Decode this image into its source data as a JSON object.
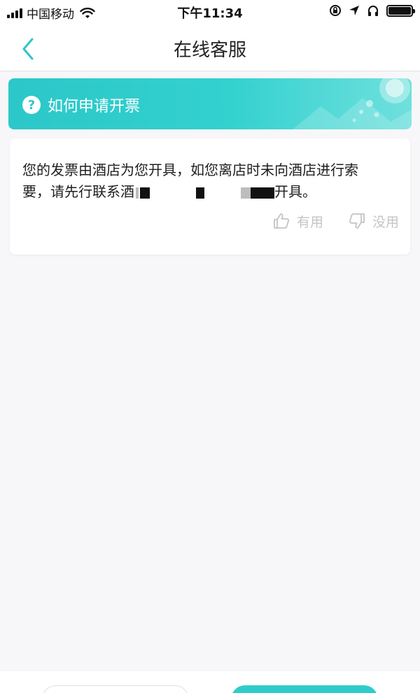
{
  "status_bar": {
    "carrier": "中国移动",
    "time": "下午11:34"
  },
  "nav": {
    "title": "在线客服"
  },
  "question": {
    "title": "如何申请开票"
  },
  "answer": {
    "text_line1": "您的发票由酒店为您开具，如您离店时未向酒店进行索",
    "text_line2_prefix": "要，请先行联系酒",
    "text_line2_suffix": "开具。"
  },
  "feedback": {
    "helpful_label": "有用",
    "not_helpful_label": "没用"
  },
  "colors": {
    "accent": "#2cc7c9",
    "background": "#f7f7f9",
    "muted": "#c4c4c8"
  }
}
